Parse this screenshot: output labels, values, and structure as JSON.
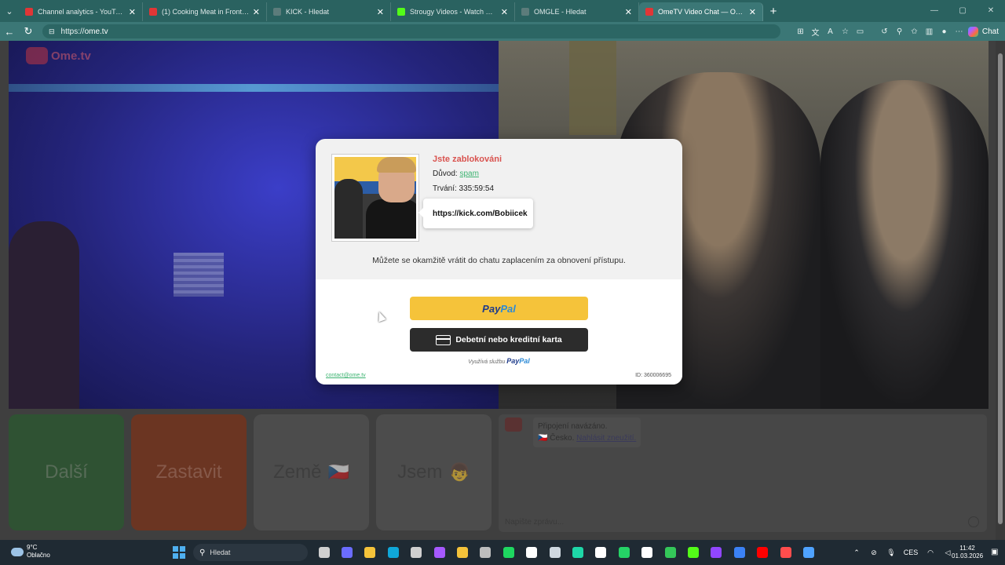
{
  "browser": {
    "tabs": [
      {
        "label": "Channel analytics - YouTube Studio",
        "color": "#e03636",
        "active": false
      },
      {
        "label": "(1) Cooking Meat in Front of Vegans",
        "color": "#e03636",
        "active": false
      },
      {
        "label": "KICK - Hledat",
        "color": "#888888",
        "active": false
      },
      {
        "label": "Strougy Videos - Watch On-Demand",
        "color": "#53fc18",
        "active": false
      },
      {
        "label": "OMGLE - Hledat",
        "color": "#888888",
        "active": false
      },
      {
        "label": "OmeTV Video Chat — Omegle",
        "color": "#e03636",
        "active": true
      }
    ],
    "url_prefix": "https://",
    "url_host": "ome.tv",
    "chat_label": "Chat"
  },
  "site": {
    "logo_text": "Ome.tv"
  },
  "controls": {
    "next_label": "Další",
    "stop_label": "Zastavit",
    "country_label": "Země",
    "country_emoji": "🇨🇿",
    "gender_label": "Jsem",
    "gender_emoji": "👦"
  },
  "chat": {
    "connected": "Připojení navázáno.",
    "country_flag": "🇨🇿",
    "country": "Česko.",
    "report": "Nahlásit zneužití.",
    "input_placeholder": "Napište zprávu..."
  },
  "modal": {
    "title": "Jste zablokováni",
    "reason_label": "Důvod:",
    "reason_value": "spam",
    "duration_label": "Trvání:",
    "duration_value": "335:59:54",
    "tooltip_url": "https://kick.com/Bobiicek",
    "message": "Můžete se okamžitě vrátit do chatu zaplacením za obnovení přístupu.",
    "paypal_a": "Pay",
    "paypal_b": "Pal",
    "card_label": "Debetní nebo kreditní karta",
    "powered_by": "Využívá službu",
    "contact": "contact@ome.tv",
    "id_label": "ID: 360006695"
  },
  "taskbar": {
    "temperature": "9°C",
    "condition": "Oblačno",
    "search_label": "Hledat",
    "language": "CES",
    "time": "11:42",
    "date": "01.03.2026",
    "app_colors": [
      "#cfcfcf",
      "#6b6cff",
      "#f5c33a",
      "#0fa7d9",
      "#d0d0d0",
      "#a659ff",
      "#f5c33a",
      "#bdbdbd",
      "#1ed760",
      "#ffffff",
      "#cfd8e0",
      "#1ed7a7",
      "#ffffff",
      "#25d366",
      "#ffffff",
      "#34c759",
      "#53fc18",
      "#9146ff",
      "#3b82f6",
      "#ff0000",
      "#ff4d4d",
      "#4fa3ff"
    ]
  }
}
